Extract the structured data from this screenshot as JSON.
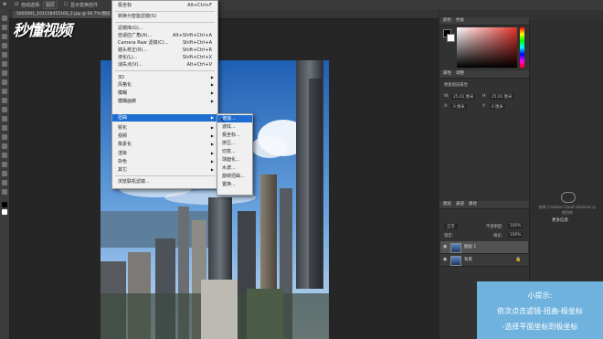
{
  "options_bar": {
    "auto_select_label": "自动选择:",
    "auto_select_value": "图层",
    "transform_label": "显示变换控件"
  },
  "document": {
    "tab_title": "5665001_101538455160_2.jpg @ 66.7%(图层 1, RGB/8#) ×"
  },
  "watermark": {
    "text": "秒懂视频"
  },
  "menu": {
    "items": [
      {
        "label": "极坐标",
        "shortcut": "Alt+Ctrl+F"
      },
      {
        "label": "转换为智能滤镜(S)",
        "shortcut": ""
      },
      {
        "label": "滤镜库(G)...",
        "shortcut": ""
      },
      {
        "label": "自适应广角(A)...",
        "shortcut": "Alt+Shift+Ctrl+A"
      },
      {
        "label": "Camera Raw 滤镜(C)...",
        "shortcut": "Shift+Ctrl+A"
      },
      {
        "label": "镜头校正(R)...",
        "shortcut": "Shift+Ctrl+R"
      },
      {
        "label": "液化(L)...",
        "shortcut": "Shift+Ctrl+X"
      },
      {
        "label": "消失点(V)...",
        "shortcut": "Alt+Ctrl+V"
      },
      {
        "label": "3D",
        "shortcut": ""
      },
      {
        "label": "风格化",
        "shortcut": ""
      },
      {
        "label": "模糊",
        "shortcut": ""
      },
      {
        "label": "模糊画廊",
        "shortcut": ""
      },
      {
        "label": "扭曲",
        "shortcut": ""
      },
      {
        "label": "锐化",
        "shortcut": ""
      },
      {
        "label": "视频",
        "shortcut": ""
      },
      {
        "label": "像素化",
        "shortcut": ""
      },
      {
        "label": "渲染",
        "shortcut": ""
      },
      {
        "label": "杂色",
        "shortcut": ""
      },
      {
        "label": "其它",
        "shortcut": ""
      },
      {
        "label": "浏览联机滤镜...",
        "shortcut": ""
      }
    ],
    "highlighted": "扭曲"
  },
  "submenu": {
    "items": [
      "波浪...",
      "波纹...",
      "极坐标...",
      "挤压...",
      "切变...",
      "球面化...",
      "水波...",
      "旋转扭曲...",
      "置换..."
    ],
    "highlighted": "波浪..."
  },
  "right_panel": {
    "color_tabs": [
      "颜色",
      "色板"
    ],
    "props_tabs": [
      "属性",
      "调整"
    ],
    "props_subtitle": "像素图层属性",
    "w_label": "W:",
    "w_value": "25.01 厘米",
    "h_label": "H:",
    "h_value": "25.01 厘米",
    "x_label": "X:",
    "x_value": "0 厘米",
    "y_label": "Y:",
    "y_value": "0 厘米",
    "layers_tabs": [
      "图层",
      "通道",
      "路径"
    ],
    "blend_mode": "正常",
    "opacity_label": "不透明度:",
    "opacity_value": "100%",
    "fill_label": "填充:",
    "fill_value": "100%",
    "lock_label": "锁定:",
    "layers": [
      {
        "name": "图层 1",
        "selected": true
      },
      {
        "name": "背景",
        "selected": false
      }
    ],
    "libraries_message": "安装 Creative Cloud Libraries 以使用库",
    "libraries_link": "更多信息"
  },
  "tip_box": {
    "title": "小提示:",
    "line1": "依次点击滤镜-扭曲-极坐标",
    "line2": "-选择平面坐标到极坐标"
  },
  "colors": {
    "highlight": "#1e6ed2",
    "tip_background": "#6fb2de"
  }
}
